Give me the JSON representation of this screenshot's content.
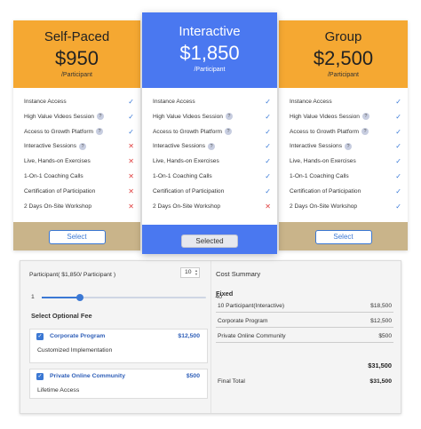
{
  "plans": [
    {
      "name": "Self-Paced",
      "price": "$950",
      "unit": "/Participant",
      "button": "Select",
      "features": [
        {
          "label": "Instance Access",
          "info": false,
          "included": true
        },
        {
          "label": "High Value Videos Session",
          "info": true,
          "included": true
        },
        {
          "label": "Access to Growth Platform",
          "info": true,
          "included": true
        },
        {
          "label": "Interactive Sessions",
          "info": true,
          "included": false
        },
        {
          "label": "Live, Hands-on Exercises",
          "info": false,
          "included": false
        },
        {
          "label": "1-On-1 Coaching Calls",
          "info": false,
          "included": false
        },
        {
          "label": "Certification of Participation",
          "info": false,
          "included": false
        },
        {
          "label": "2 Days On-Site Workshop",
          "info": false,
          "included": false
        }
      ]
    },
    {
      "name": "Interactive",
      "price": "$1,850",
      "unit": "/Participant",
      "button": "Selected",
      "features": [
        {
          "label": "Instance Access",
          "info": false,
          "included": true
        },
        {
          "label": "High Value Videos Session",
          "info": true,
          "included": true
        },
        {
          "label": "Access to Growth Platform",
          "info": true,
          "included": true
        },
        {
          "label": "Interactive Sessions",
          "info": true,
          "included": true
        },
        {
          "label": "Live, Hands-on Exercises",
          "info": false,
          "included": true
        },
        {
          "label": "1-On-1 Coaching Calls",
          "info": false,
          "included": true
        },
        {
          "label": "Certification of Participation",
          "info": false,
          "included": true
        },
        {
          "label": "2 Days On-Site Workshop",
          "info": false,
          "included": false
        }
      ]
    },
    {
      "name": "Group",
      "price": "$2,500",
      "unit": "/Participant",
      "button": "Select",
      "features": [
        {
          "label": "Instance Access",
          "info": false,
          "included": true
        },
        {
          "label": "High Value Videos Session",
          "info": true,
          "included": true
        },
        {
          "label": "Access to Growth Platform",
          "info": true,
          "included": true
        },
        {
          "label": "Interactive Sessions",
          "info": true,
          "included": true
        },
        {
          "label": "Live, Hands-on Exercises",
          "info": false,
          "included": true
        },
        {
          "label": "1-On-1 Coaching Calls",
          "info": false,
          "included": true
        },
        {
          "label": "Certification of Participation",
          "info": false,
          "included": true
        },
        {
          "label": "2 Days On-Site Workshop",
          "info": false,
          "included": true
        }
      ]
    }
  ],
  "icons": {
    "info": "question-icon",
    "included": "check-icon",
    "excluded": "x-icon"
  },
  "colors": {
    "orange": "#f5a832",
    "blue": "#4a78f0",
    "tan": "#c9b48a",
    "check": "#3a7ad8",
    "cross": "#e04040"
  },
  "calculator": {
    "participant_label": "Participant( $1,850/ Participant )",
    "quantity": "10",
    "slider": {
      "min": "1",
      "max": "40",
      "value": 10
    },
    "optional_title": "Select Optional Fee",
    "fees": [
      {
        "name": "Corporate Program",
        "price": "$12,500",
        "description": "Customized Implementation",
        "checked": true
      },
      {
        "name": "Private Online Community",
        "price": "$500",
        "description": "Lifetime Access",
        "checked": true
      }
    ],
    "summary": {
      "title": "Cost Summary",
      "fixed_label": "Fixed",
      "rows": [
        {
          "label": "10 Participant(Interactive)",
          "amount": "$18,500"
        },
        {
          "label": "Corporate Program",
          "amount": "$12,500"
        },
        {
          "label": "Private Online Community",
          "amount": "$500"
        }
      ],
      "subtotal": "$31,500",
      "final_label": "Final Total",
      "final_amount": "$31,500"
    }
  }
}
